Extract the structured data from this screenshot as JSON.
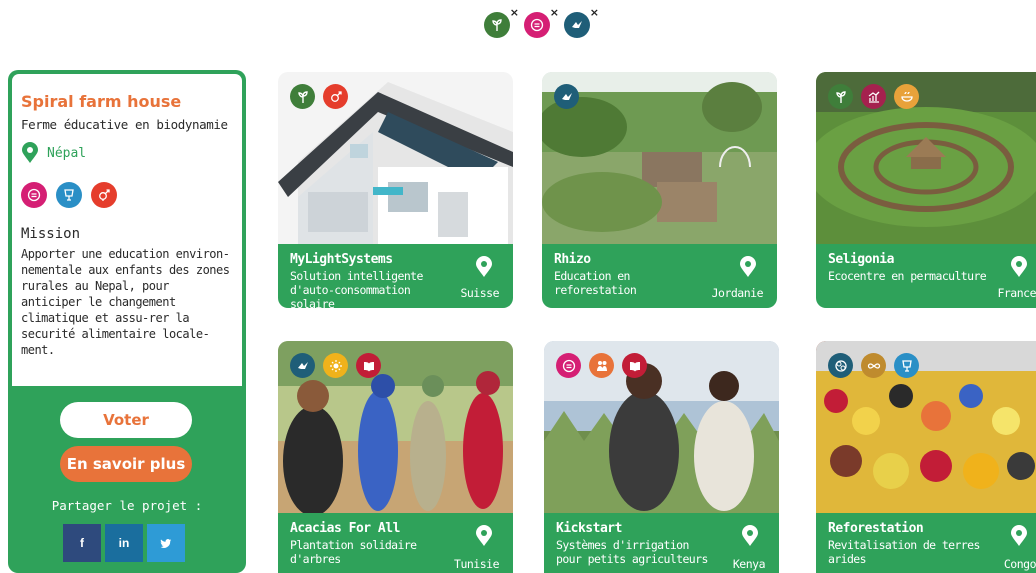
{
  "filters": [
    {
      "name": "sdg-filter-growth",
      "icon": "sprout-icon",
      "color": "#3f7e3a",
      "remove": "×"
    },
    {
      "name": "sdg-filter-equality",
      "icon": "equal-icon",
      "color": "#d51f74",
      "remove": "×"
    },
    {
      "name": "sdg-filter-life-on-land",
      "icon": "bird-icon",
      "color": "#1f5e78",
      "remove": "×"
    }
  ],
  "panel": {
    "title": "Spiral farm house",
    "subtitle": "Ferme éducative en biodynamie",
    "location": "Népal",
    "odds": [
      {
        "icon": "equal-icon",
        "color": "#d51f74"
      },
      {
        "icon": "cup-icon",
        "color": "#2a8fc6"
      },
      {
        "icon": "gender-icon",
        "color": "#e53d2c"
      }
    ],
    "mission_heading": "Mission",
    "mission": "Apporter une education environ-nementale aux enfants des zones rurales au Nepal, pour anticiper le changement climatique et assu-rer la securité alimentaire locale-ment.",
    "vote_label": "Voter",
    "more_label": "En savoir plus",
    "share_label": "Partager le projet :",
    "socials": [
      {
        "label": "f",
        "color": "#2e4a7d"
      },
      {
        "label": "in",
        "color": "#1a6e9e"
      },
      {
        "label": "🐦",
        "color": "#2e9bd6"
      }
    ]
  },
  "projects": [
    {
      "name": "MyLightSystems",
      "description": "Solution intelligente d'auto-consommation solaire",
      "country": "Suisse",
      "odds": [
        {
          "icon": "sprout-icon",
          "color": "#3f7e3a"
        },
        {
          "icon": "gender-icon",
          "color": "#e53d2c"
        }
      ]
    },
    {
      "name": "Rhizo",
      "description": "Education en reforestation",
      "country": "Jordanie",
      "odds": [
        {
          "icon": "bird-icon",
          "color": "#1f5e78"
        }
      ]
    },
    {
      "name": "Seligonia",
      "description": "Ecocentre en permaculture",
      "country": "France",
      "odds": [
        {
          "icon": "sprout-icon",
          "color": "#3f7e3a"
        },
        {
          "icon": "chart-icon",
          "color": "#a5214e"
        },
        {
          "icon": "bowl-icon",
          "color": "#e8a23a"
        }
      ]
    },
    {
      "name": "Acacias For All",
      "description": "Plantation solidaire d'arbres",
      "country": "Tunisie",
      "odds": [
        {
          "icon": "bird-icon",
          "color": "#1f5e78"
        },
        {
          "icon": "sun-icon",
          "color": "#f0b21b"
        },
        {
          "icon": "book-icon",
          "color": "#c21d37"
        }
      ]
    },
    {
      "name": "Kickstart",
      "description": "Systèmes d'irrigation pour petits agriculteurs",
      "country": "Kenya",
      "odds": [
        {
          "icon": "equal-icon",
          "color": "#d51f74"
        },
        {
          "icon": "people-icon",
          "color": "#e8733a"
        },
        {
          "icon": "book-icon",
          "color": "#c21d37"
        }
      ]
    },
    {
      "name": "Reforestation",
      "description": "Revitalisation de terres arides",
      "country": "Congo",
      "odds": [
        {
          "icon": "globe-icon",
          "color": "#1f5e78"
        },
        {
          "icon": "infinity-icon",
          "color": "#bf8b2e"
        },
        {
          "icon": "cup-icon",
          "color": "#2a8fc6"
        }
      ]
    }
  ]
}
